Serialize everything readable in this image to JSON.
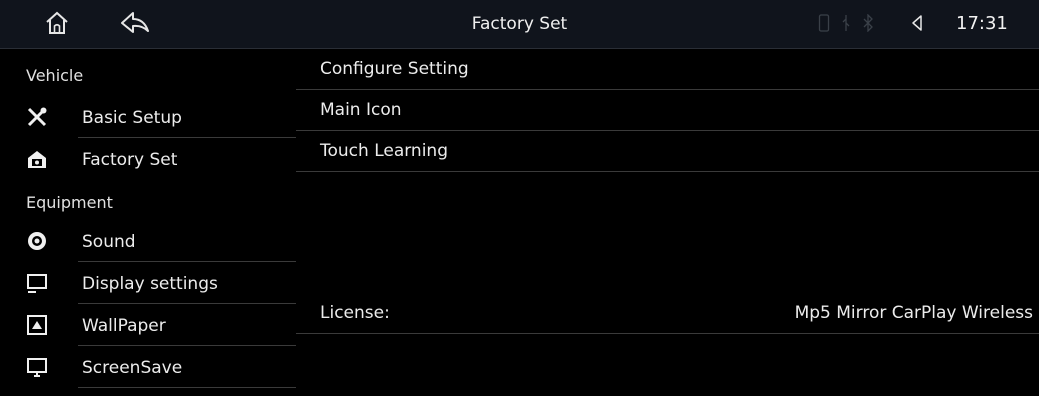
{
  "header": {
    "title": "Factory Set",
    "time": "17:31",
    "icons": [
      "home-icon",
      "back-icon",
      "phone-icon",
      "usb-icon",
      "bluetooth-icon",
      "volume-icon"
    ]
  },
  "sidebar": {
    "sections": [
      {
        "title": "Vehicle",
        "items": [
          {
            "label": "Basic Setup",
            "icon": "tools-icon"
          },
          {
            "label": "Factory Set",
            "icon": "factory-icon"
          }
        ]
      },
      {
        "title": "Equipment",
        "items": [
          {
            "label": "Sound",
            "icon": "sound-icon"
          },
          {
            "label": "Display settings",
            "icon": "display-icon"
          },
          {
            "label": "WallPaper",
            "icon": "wallpaper-icon"
          },
          {
            "label": "ScreenSave",
            "icon": "screensaver-icon"
          }
        ]
      }
    ]
  },
  "main": {
    "items": [
      {
        "label": "Configure Setting"
      },
      {
        "label": "Main Icon"
      },
      {
        "label": "Touch Learning"
      }
    ],
    "license": {
      "label": "License:",
      "value": "Mp5 Mirror CarPlay Wireless"
    }
  }
}
